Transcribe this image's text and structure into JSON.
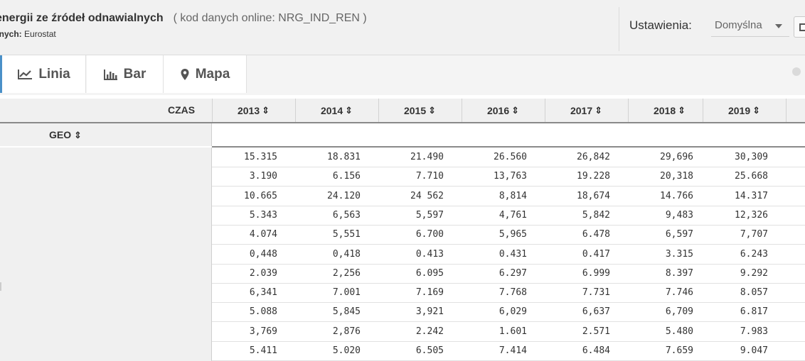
{
  "header": {
    "title": "energii ze źródeł odnawialnych",
    "code": "( kod danych online: NRG_IND_REN )",
    "source_label": "anych:",
    "source_value": "Eurostat"
  },
  "settings": {
    "label": "Ustawienia:",
    "selected": "Domyślna"
  },
  "tabs": [
    {
      "label": "Linia",
      "icon": "line-chart-icon"
    },
    {
      "label": "Bar",
      "icon": "bar-chart-icon"
    },
    {
      "label": "Mapa",
      "icon": "map-pin-icon"
    }
  ],
  "table": {
    "time_label": "CZAS",
    "geo_label": "GEO",
    "years": [
      "2013",
      "2014",
      "2015",
      "2016",
      "2017",
      "2018",
      "2019"
    ],
    "rows": [
      [
        "15.315",
        "18.831",
        "21.490",
        "26.560",
        "26,842",
        "29,696",
        "30,309"
      ],
      [
        "3.190",
        "6.156",
        "7.710",
        "13,763",
        "19.228",
        "20,318",
        "25.668"
      ],
      [
        "10.665",
        "24.120",
        "24 562",
        "8,814",
        "18,674",
        "14.766",
        "14.317"
      ],
      [
        "5.343",
        "6,563",
        "5,597",
        "4,761",
        "5,842",
        "9,483",
        "12,326"
      ],
      [
        "4.074",
        "5,551",
        "6.700",
        "5,965",
        "6.478",
        "6,597",
        "7,707"
      ],
      [
        "0,448",
        "0,418",
        "0.413",
        "0.431",
        "0.417",
        "3.315",
        "6.243"
      ],
      [
        "2.039",
        "2,256",
        "6.095",
        "6.297",
        "6.999",
        "8.397",
        "9.292"
      ],
      [
        "6,341",
        "7.001",
        "7.169",
        "7.768",
        "7.731",
        "7.746",
        "8.057"
      ],
      [
        "5.088",
        "5,845",
        "3,921",
        "6,029",
        "6,637",
        "6,709",
        "6.817"
      ],
      [
        "3,769",
        "2,876",
        "2.242",
        "1.601",
        "2.571",
        "5.480",
        "7.983"
      ],
      [
        "5.411",
        "5.020",
        "6.505",
        "7.414",
        "6.484",
        "7.659",
        "9.047"
      ]
    ]
  },
  "colors": {
    "header_bg": "#f1f1f1",
    "active_tab_accent": "#4a90c8",
    "table_header_bg": "#f0f0f0"
  }
}
